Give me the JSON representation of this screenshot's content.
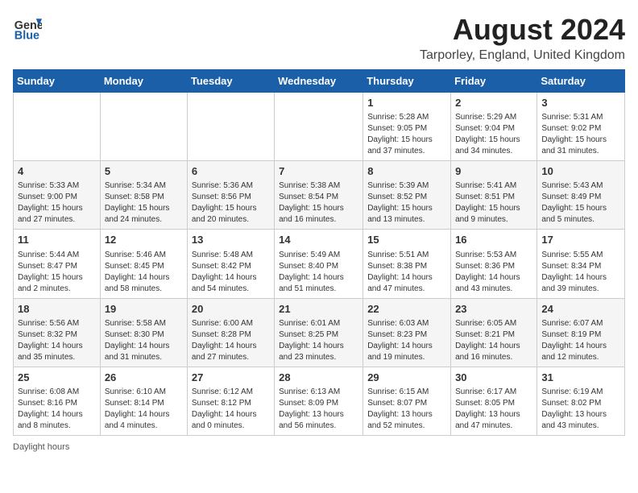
{
  "header": {
    "logo_general": "General",
    "logo_blue": "Blue",
    "main_title": "August 2024",
    "subtitle": "Tarporley, England, United Kingdom"
  },
  "calendar": {
    "days_of_week": [
      "Sunday",
      "Monday",
      "Tuesday",
      "Wednesday",
      "Thursday",
      "Friday",
      "Saturday"
    ],
    "weeks": [
      [
        {
          "day": "",
          "info": ""
        },
        {
          "day": "",
          "info": ""
        },
        {
          "day": "",
          "info": ""
        },
        {
          "day": "",
          "info": ""
        },
        {
          "day": "1",
          "info": "Sunrise: 5:28 AM\nSunset: 9:05 PM\nDaylight: 15 hours and 37 minutes."
        },
        {
          "day": "2",
          "info": "Sunrise: 5:29 AM\nSunset: 9:04 PM\nDaylight: 15 hours and 34 minutes."
        },
        {
          "day": "3",
          "info": "Sunrise: 5:31 AM\nSunset: 9:02 PM\nDaylight: 15 hours and 31 minutes."
        }
      ],
      [
        {
          "day": "4",
          "info": "Sunrise: 5:33 AM\nSunset: 9:00 PM\nDaylight: 15 hours and 27 minutes."
        },
        {
          "day": "5",
          "info": "Sunrise: 5:34 AM\nSunset: 8:58 PM\nDaylight: 15 hours and 24 minutes."
        },
        {
          "day": "6",
          "info": "Sunrise: 5:36 AM\nSunset: 8:56 PM\nDaylight: 15 hours and 20 minutes."
        },
        {
          "day": "7",
          "info": "Sunrise: 5:38 AM\nSunset: 8:54 PM\nDaylight: 15 hours and 16 minutes."
        },
        {
          "day": "8",
          "info": "Sunrise: 5:39 AM\nSunset: 8:52 PM\nDaylight: 15 hours and 13 minutes."
        },
        {
          "day": "9",
          "info": "Sunrise: 5:41 AM\nSunset: 8:51 PM\nDaylight: 15 hours and 9 minutes."
        },
        {
          "day": "10",
          "info": "Sunrise: 5:43 AM\nSunset: 8:49 PM\nDaylight: 15 hours and 5 minutes."
        }
      ],
      [
        {
          "day": "11",
          "info": "Sunrise: 5:44 AM\nSunset: 8:47 PM\nDaylight: 15 hours and 2 minutes."
        },
        {
          "day": "12",
          "info": "Sunrise: 5:46 AM\nSunset: 8:45 PM\nDaylight: 14 hours and 58 minutes."
        },
        {
          "day": "13",
          "info": "Sunrise: 5:48 AM\nSunset: 8:42 PM\nDaylight: 14 hours and 54 minutes."
        },
        {
          "day": "14",
          "info": "Sunrise: 5:49 AM\nSunset: 8:40 PM\nDaylight: 14 hours and 51 minutes."
        },
        {
          "day": "15",
          "info": "Sunrise: 5:51 AM\nSunset: 8:38 PM\nDaylight: 14 hours and 47 minutes."
        },
        {
          "day": "16",
          "info": "Sunrise: 5:53 AM\nSunset: 8:36 PM\nDaylight: 14 hours and 43 minutes."
        },
        {
          "day": "17",
          "info": "Sunrise: 5:55 AM\nSunset: 8:34 PM\nDaylight: 14 hours and 39 minutes."
        }
      ],
      [
        {
          "day": "18",
          "info": "Sunrise: 5:56 AM\nSunset: 8:32 PM\nDaylight: 14 hours and 35 minutes."
        },
        {
          "day": "19",
          "info": "Sunrise: 5:58 AM\nSunset: 8:30 PM\nDaylight: 14 hours and 31 minutes."
        },
        {
          "day": "20",
          "info": "Sunrise: 6:00 AM\nSunset: 8:28 PM\nDaylight: 14 hours and 27 minutes."
        },
        {
          "day": "21",
          "info": "Sunrise: 6:01 AM\nSunset: 8:25 PM\nDaylight: 14 hours and 23 minutes."
        },
        {
          "day": "22",
          "info": "Sunrise: 6:03 AM\nSunset: 8:23 PM\nDaylight: 14 hours and 19 minutes."
        },
        {
          "day": "23",
          "info": "Sunrise: 6:05 AM\nSunset: 8:21 PM\nDaylight: 14 hours and 16 minutes."
        },
        {
          "day": "24",
          "info": "Sunrise: 6:07 AM\nSunset: 8:19 PM\nDaylight: 14 hours and 12 minutes."
        }
      ],
      [
        {
          "day": "25",
          "info": "Sunrise: 6:08 AM\nSunset: 8:16 PM\nDaylight: 14 hours and 8 minutes."
        },
        {
          "day": "26",
          "info": "Sunrise: 6:10 AM\nSunset: 8:14 PM\nDaylight: 14 hours and 4 minutes."
        },
        {
          "day": "27",
          "info": "Sunrise: 6:12 AM\nSunset: 8:12 PM\nDaylight: 14 hours and 0 minutes."
        },
        {
          "day": "28",
          "info": "Sunrise: 6:13 AM\nSunset: 8:09 PM\nDaylight: 13 hours and 56 minutes."
        },
        {
          "day": "29",
          "info": "Sunrise: 6:15 AM\nSunset: 8:07 PM\nDaylight: 13 hours and 52 minutes."
        },
        {
          "day": "30",
          "info": "Sunrise: 6:17 AM\nSunset: 8:05 PM\nDaylight: 13 hours and 47 minutes."
        },
        {
          "day": "31",
          "info": "Sunrise: 6:19 AM\nSunset: 8:02 PM\nDaylight: 13 hours and 43 minutes."
        }
      ]
    ]
  },
  "footer": {
    "daylight_label": "Daylight hours"
  }
}
